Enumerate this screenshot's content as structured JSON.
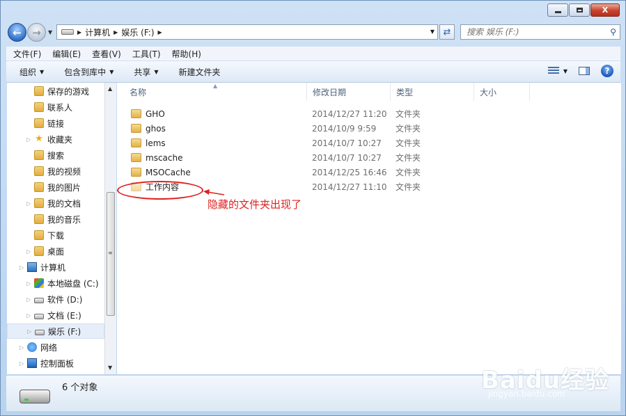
{
  "window": {
    "close_glyph": "X"
  },
  "nav": {
    "breadcrumb": [
      "计算机",
      "娱乐 (F:)"
    ],
    "search_placeholder": "搜索 娱乐 (F:)"
  },
  "menu": [
    "文件(F)",
    "编辑(E)",
    "查看(V)",
    "工具(T)",
    "帮助(H)"
  ],
  "toolbar": {
    "organize": "组织",
    "include_library": "包含到库中",
    "share": "共享",
    "new_folder": "新建文件夹"
  },
  "tree": [
    {
      "label": "保存的游戏",
      "icon": "folder-icon",
      "expander": false
    },
    {
      "label": "联系人",
      "icon": "folder-icon",
      "expander": false
    },
    {
      "label": "链接",
      "icon": "folder-icon",
      "expander": false
    },
    {
      "label": "收藏夹",
      "icon": "star-icon",
      "expander": true
    },
    {
      "label": "搜索",
      "icon": "folder-icon",
      "expander": false
    },
    {
      "label": "我的视频",
      "icon": "folder-icon",
      "expander": false
    },
    {
      "label": "我的图片",
      "icon": "folder-icon",
      "expander": false
    },
    {
      "label": "我的文档",
      "icon": "folder-icon",
      "expander": true
    },
    {
      "label": "我的音乐",
      "icon": "folder-icon",
      "expander": false
    },
    {
      "label": "下载",
      "icon": "folder-icon",
      "expander": false
    },
    {
      "label": "桌面",
      "icon": "folder-icon",
      "expander": true
    },
    {
      "label": "计算机",
      "icon": "computer-icon",
      "expander": true
    },
    {
      "label": "本地磁盘 (C:)",
      "icon": "windows-drive-icon",
      "expander": true
    },
    {
      "label": "软件 (D:)",
      "icon": "drive-icon",
      "expander": true
    },
    {
      "label": "文档 (E:)",
      "icon": "drive-icon",
      "expander": true
    },
    {
      "label": "娱乐 (F:)",
      "icon": "drive-icon",
      "expander": true,
      "selected": true
    },
    {
      "label": "网络",
      "icon": "network-icon",
      "expander": true
    },
    {
      "label": "控制面板",
      "icon": "control-panel-icon",
      "expander": true
    }
  ],
  "columns": [
    "名称",
    "修改日期",
    "类型",
    "大小"
  ],
  "files": [
    {
      "name": "GHO",
      "date": "2014/12/27 11:20",
      "type": "文件夹",
      "hidden": false
    },
    {
      "name": "ghos",
      "date": "2014/10/9 9:59",
      "type": "文件夹",
      "hidden": false
    },
    {
      "name": "lems",
      "date": "2014/10/7 10:27",
      "type": "文件夹",
      "hidden": false
    },
    {
      "name": "mscache",
      "date": "2014/10/7 10:27",
      "type": "文件夹",
      "hidden": false
    },
    {
      "name": "MSOCache",
      "date": "2014/12/25 16:46",
      "type": "文件夹",
      "hidden": false
    },
    {
      "name": "工作内容",
      "date": "2014/12/27 11:10",
      "type": "文件夹",
      "hidden": true
    }
  ],
  "annotation": "隐藏的文件夹出现了",
  "status": {
    "count": "6 个对象"
  },
  "watermark": {
    "main": "Baidu经验",
    "sub": "jingyan.baidu.com"
  },
  "colors": {
    "annotation": "#e02020",
    "accent": "#2c6eb8"
  }
}
